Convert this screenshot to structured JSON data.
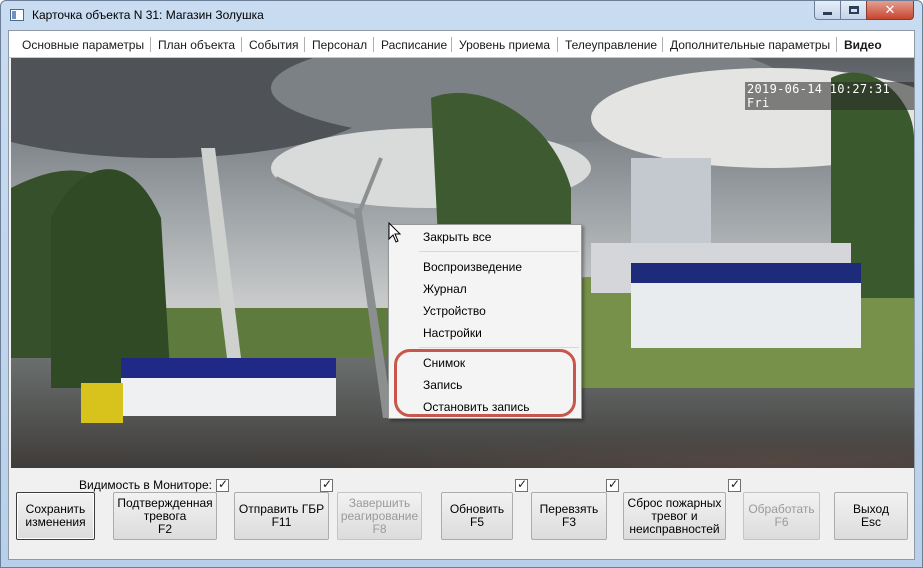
{
  "window": {
    "title": "Карточка объекта N 31: Магазин Золушка",
    "close_glyph": "✕"
  },
  "tabs": [
    {
      "label": "Основные параметры"
    },
    {
      "label": "План объекта"
    },
    {
      "label": "События"
    },
    {
      "label": "Персонал"
    },
    {
      "label": "Расписание"
    },
    {
      "label": "Уровень приема"
    },
    {
      "label": "Телеуправление"
    },
    {
      "label": "Дополнительные параметры"
    },
    {
      "label": "Видео",
      "active": true
    }
  ],
  "video": {
    "timestamp": "2019-06-14 10:27:31 Fri"
  },
  "context_menu": {
    "items": [
      {
        "label": "Закрыть все"
      },
      {
        "label": "Воспроизведение"
      },
      {
        "label": "Журнал"
      },
      {
        "label": "Устройство"
      },
      {
        "label": "Настройки"
      },
      {
        "label": "Снимок"
      },
      {
        "label": "Запись"
      },
      {
        "label": "Остановить запись"
      }
    ],
    "highlight_color": "#c0392b"
  },
  "bottom": {
    "visibility_label": "Видимость в Мониторе:",
    "checkboxes_checked": true,
    "buttons": [
      {
        "label": "Сохранить\nизменения",
        "enabled": true
      },
      {
        "label": "Подтвержденная\nтревога\nF2",
        "enabled": true
      },
      {
        "label": "Отправить ГБР\nF11",
        "enabled": true
      },
      {
        "label": "Завершить\nреагирование\nF8",
        "enabled": false
      },
      {
        "label": "Обновить\nF5",
        "enabled": true
      },
      {
        "label": "Перевзять\nF3",
        "enabled": true
      },
      {
        "label": "Сброс пожарных\nтревог и\nнеисправностей",
        "enabled": true
      },
      {
        "label": "Обработать\nF6",
        "enabled": false
      },
      {
        "label": "Выход\nEsc",
        "enabled": true
      }
    ]
  }
}
